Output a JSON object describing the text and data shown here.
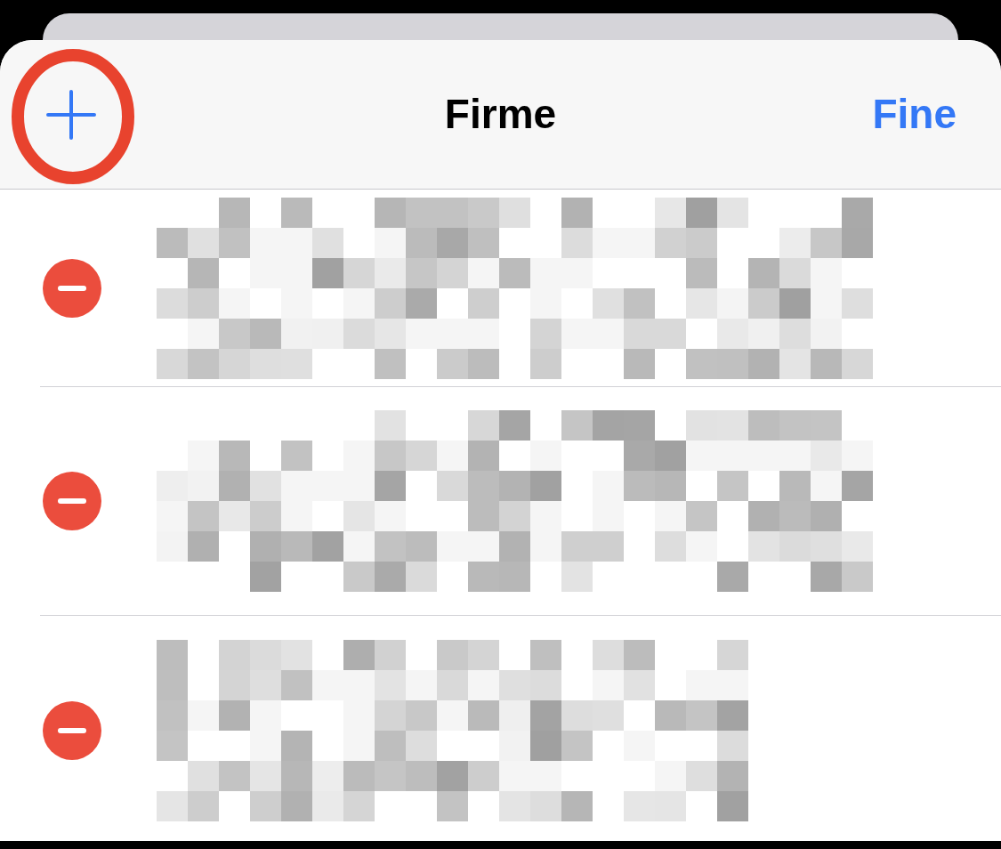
{
  "header": {
    "title": "Firme",
    "done_button": "Fine"
  }
}
